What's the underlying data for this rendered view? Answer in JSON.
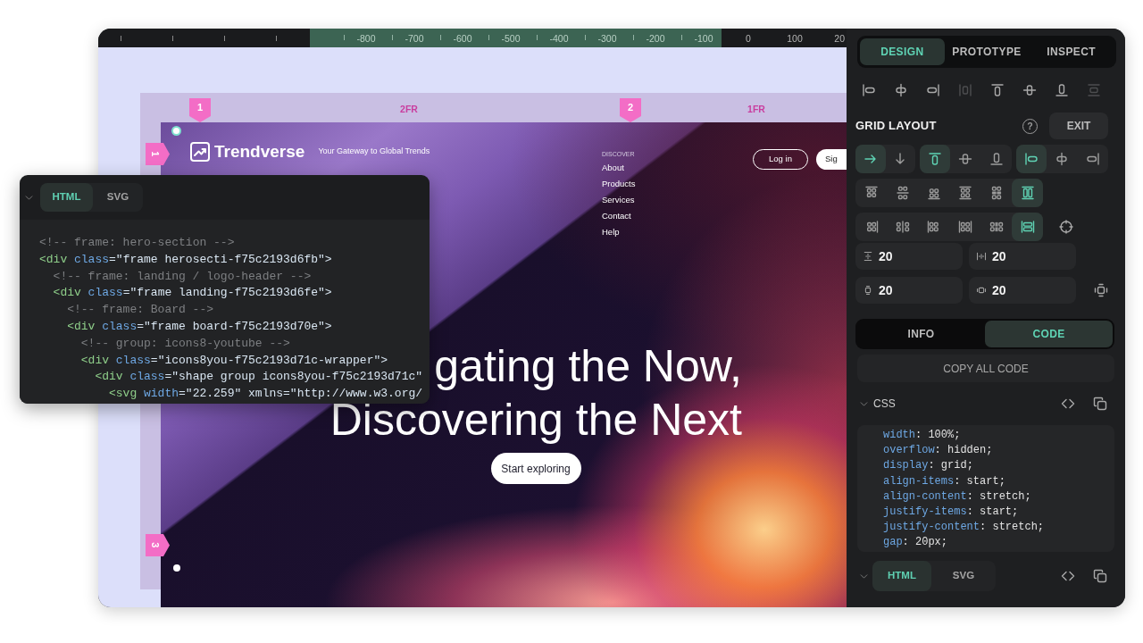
{
  "ruler": {
    "selection_labels": [
      "-800",
      "-700",
      "-600",
      "-500",
      "-400",
      "-300",
      "-200",
      "-100"
    ],
    "labels": [
      "0",
      "100",
      "20"
    ]
  },
  "grid_overlay": {
    "column_markers": [
      "1",
      "2"
    ],
    "column_tracks": [
      "2FR",
      "1FR"
    ],
    "row_markers": [
      "1",
      "3"
    ]
  },
  "website": {
    "logo": "Trendverse",
    "tagline": "Your Gateway to Global Trends",
    "nav_heading": "DISCOVER",
    "nav_links": [
      "About",
      "Products",
      "Services",
      "Contact",
      "Help"
    ],
    "login_button": "Log in",
    "signup_button": "Sig",
    "headline": [
      "gating the Now,",
      "Discovering the Next"
    ],
    "cta_button": "Start exploring"
  },
  "code_panel": {
    "expanded": true,
    "tabs": [
      {
        "label": "HTML",
        "selected": true
      },
      {
        "label": "SVG",
        "selected": false
      }
    ],
    "lines": [
      {
        "kind": "comment",
        "text": "<!-- frame: hero-section -->"
      },
      {
        "kind": "tag",
        "text": "<div class=\"frame herosecti-f75c2193d6fb\">",
        "children": [
          {
            "kind": "comment",
            "text": "<!-- frame: landing / logo-header -->"
          },
          {
            "kind": "tag",
            "text": "<div class=\"frame landing-f75c2193d6fe\">",
            "children": [
              {
                "kind": "comment",
                "text": "<!-- frame: Board -->"
              },
              {
                "kind": "tag",
                "text": "<div class=\"frame board-f75c2193d70e\">",
                "children": [
                  {
                    "kind": "comment",
                    "text": "<!-- group: icons8-youtube -->"
                  },
                  {
                    "kind": "tag",
                    "text": "<div class=\"icons8you-f75c2193d71c-wrapper\">",
                    "children": [
                      {
                        "kind": "tag",
                        "text": "<div class=\"shape group icons8you-f75c2193d71c\"",
                        "children": [
                          {
                            "kind": "tag",
                            "text": "<svg width=\"22.259\" xmlns=\"http://www.w3.org/"
                          }
                        ]
                      }
                    ]
                  }
                ]
              }
            ]
          }
        ]
      }
    ]
  },
  "inspector": {
    "tabs": [
      {
        "label": "DESIGN",
        "selected": true
      },
      {
        "label": "PROTOTYPE",
        "selected": false
      },
      {
        "label": "INSPECT",
        "selected": false
      }
    ],
    "align_tools": [
      {
        "kind": "left",
        "disabled": false
      },
      {
        "kind": "hcenter",
        "disabled": false
      },
      {
        "kind": "right",
        "disabled": false
      },
      {
        "kind": "hdistribute",
        "disabled": true
      },
      {
        "kind": "top",
        "disabled": false
      },
      {
        "kind": "vcenter",
        "disabled": false
      },
      {
        "kind": "bottom",
        "disabled": false
      },
      {
        "kind": "vdistribute",
        "disabled": true
      }
    ],
    "grid_layout": {
      "title": "GRID LAYOUT",
      "help_button": "?",
      "exit_button": "EXIT",
      "direction": [
        {
          "kind": "right",
          "selected": true
        },
        {
          "kind": "down",
          "selected": false
        }
      ],
      "vertical_align": [
        {
          "kind": "top",
          "selected": true
        },
        {
          "kind": "vcenter",
          "selected": false
        },
        {
          "kind": "bottom",
          "selected": false
        }
      ],
      "horizontal_align": [
        {
          "kind": "left",
          "selected": true
        },
        {
          "kind": "hcenter",
          "selected": false
        },
        {
          "kind": "right",
          "selected": false
        }
      ],
      "align_content": [
        {
          "kind": "start",
          "selected": false
        },
        {
          "kind": "center",
          "selected": false
        },
        {
          "kind": "end",
          "selected": false
        },
        {
          "kind": "between",
          "selected": false
        },
        {
          "kind": "around",
          "selected": false
        },
        {
          "kind": "stretch",
          "selected": true
        }
      ],
      "justify_content": [
        {
          "kind": "start",
          "selected": false
        },
        {
          "kind": "center",
          "selected": false
        },
        {
          "kind": "end",
          "selected": false
        },
        {
          "kind": "between",
          "selected": false
        },
        {
          "kind": "around",
          "selected": false
        },
        {
          "kind": "stretch",
          "selected": true
        }
      ],
      "gaps": [
        {
          "kind": "rowgap",
          "value": "20"
        },
        {
          "kind": "colgap",
          "value": "20"
        }
      ],
      "paddings": [
        {
          "kind": "vpadding",
          "value": "20"
        },
        {
          "kind": "hpadding",
          "value": "20"
        }
      ]
    },
    "info_tabs": [
      {
        "label": "INFO",
        "selected": false
      },
      {
        "label": "CODE",
        "selected": true
      }
    ],
    "copy_all_button": "COPY ALL CODE",
    "css_section": {
      "title": "CSS",
      "expanded": true,
      "lines": [
        "width: 100%;",
        "overflow: hidden;",
        "display: grid;",
        "align-items: start;",
        "align-content: stretch;",
        "justify-items: start;",
        "justify-content: stretch;",
        "gap: 20px;"
      ]
    },
    "html_section": {
      "expanded": true,
      "tabs": [
        {
          "label": "HTML",
          "selected": true
        },
        {
          "label": "SVG",
          "selected": false
        }
      ]
    }
  }
}
